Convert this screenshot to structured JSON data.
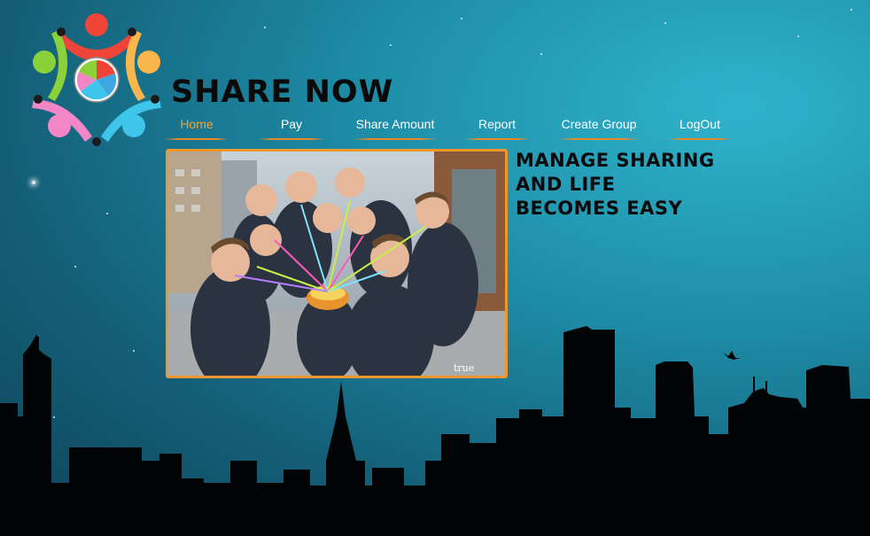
{
  "brand": {
    "title": "SHARE NOW",
    "logo_icon": "people-circle-pie-logo-icon"
  },
  "nav": {
    "items": [
      {
        "label": "Home",
        "active": true
      },
      {
        "label": "Pay",
        "active": false
      },
      {
        "label": "Share Amount",
        "active": false
      },
      {
        "label": "Report",
        "active": false
      },
      {
        "label": "Create Group",
        "active": false
      },
      {
        "label": "LogOut",
        "active": false
      }
    ]
  },
  "hero": {
    "tagline": [
      "MANAGE SHARING",
      "AND LIFE",
      "BECOMES EASY"
    ],
    "photo_watermark": "true"
  },
  "colors": {
    "accent": "#f0962c",
    "active_nav": "#f7a230",
    "text_dark": "#0a0a0a"
  }
}
